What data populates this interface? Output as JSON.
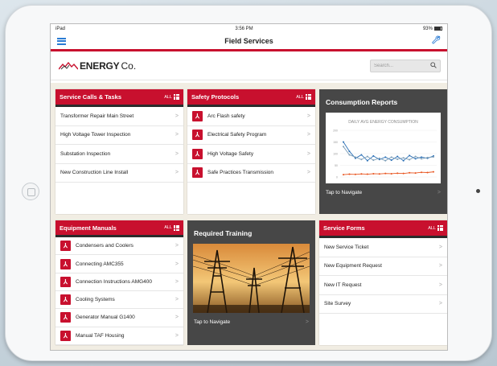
{
  "device": {
    "carrier": "iPad",
    "time": "3:56 PM",
    "battery": "93%"
  },
  "navbar": {
    "title": "Field Services",
    "menu_icon": "hamburger-icon",
    "settings_icon": "wrench-icon"
  },
  "brand": {
    "logo_strong": "ENERGY",
    "logo_light": "Co."
  },
  "search": {
    "placeholder": "Search..."
  },
  "service_calls": {
    "title": "Service Calls & Tasks",
    "all_label": "ALL",
    "items": [
      "Transformer Repair Main Street",
      "High Voltage Tower Inspection",
      "Substation Inspection",
      "New Construction Line Install"
    ]
  },
  "safety": {
    "title": "Safety Protocols",
    "all_label": "ALL",
    "items": [
      "Arc Flash safety",
      "Electrical Safety Program",
      "High Voltage Safety",
      "Safe Practices Transmission"
    ]
  },
  "consumption": {
    "title": "Consumption Reports",
    "tap_label": "Tap to Navigate",
    "chart_data": {
      "type": "line",
      "title": "DAILY AVG ENERGY CONSUMPTION",
      "ylim": [
        0,
        200
      ],
      "yticks": [
        0,
        50,
        100,
        150,
        200
      ],
      "series": [
        {
          "color": "#2a6fb5",
          "values": [
            150,
            110,
            80,
            95,
            70,
            90,
            75,
            85,
            72,
            88,
            70,
            92,
            78,
            85,
            80,
            90
          ]
        },
        {
          "color": "#7f9fb8",
          "values": [
            130,
            95,
            85,
            75,
            88,
            72,
            80,
            70,
            85,
            76,
            82,
            74,
            88,
            78,
            83,
            86
          ]
        },
        {
          "color": "#e8541e",
          "values": [
            10,
            12,
            11,
            13,
            12,
            14,
            13,
            15,
            14,
            16,
            15,
            18,
            17,
            20,
            19,
            22
          ]
        }
      ]
    }
  },
  "equipment": {
    "title": "Equipment Manuals",
    "all_label": "ALL",
    "items": [
      "Condensers and Coolers",
      "Connecting AMC355",
      "Connection Instructions AMG400",
      "Cooling Systems",
      "Generator Manual G1400",
      "Manual TAF Housing"
    ]
  },
  "training": {
    "title": "Required Training",
    "tap_label": "Tap to Navigate"
  },
  "forms": {
    "title": "Service Forms",
    "all_label": "ALL",
    "items": [
      "New Service Ticket",
      "New Equipment Request",
      "New IT Request",
      "Site Survey"
    ]
  },
  "colors": {
    "brand_red": "#c8102e",
    "accent_blue": "#2a7bd4",
    "dark_tile": "#474747"
  }
}
